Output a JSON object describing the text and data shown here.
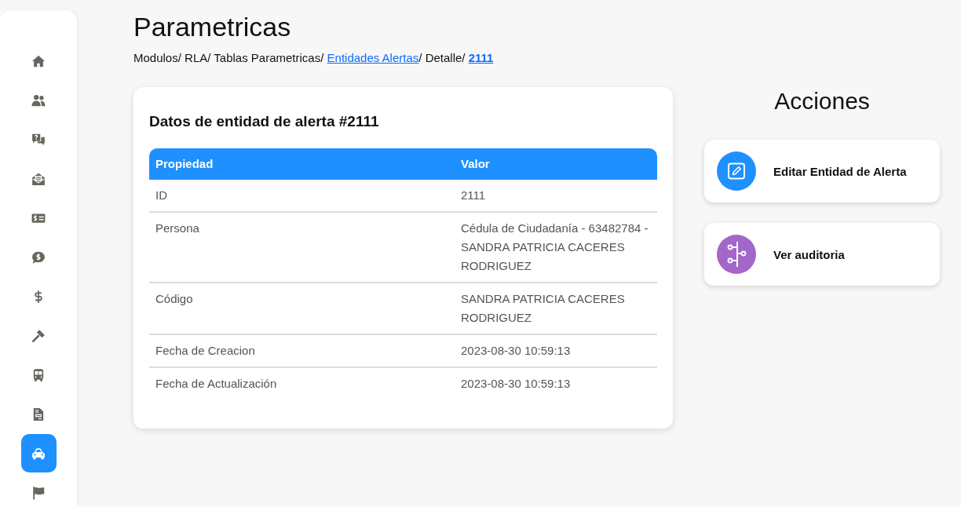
{
  "sidebar": {
    "items": [
      {
        "kind": "home",
        "selected": false
      },
      {
        "kind": "users",
        "selected": false
      },
      {
        "kind": "question-chat",
        "selected": false
      },
      {
        "kind": "envelope",
        "selected": false
      },
      {
        "kind": "money-check",
        "selected": false
      },
      {
        "kind": "dollar-chat",
        "selected": false
      },
      {
        "kind": "dollar",
        "selected": false
      },
      {
        "kind": "gavel",
        "selected": false
      },
      {
        "kind": "bus",
        "selected": false
      },
      {
        "kind": "document",
        "selected": false
      },
      {
        "kind": "car",
        "selected": true
      },
      {
        "kind": "flag",
        "selected": false
      }
    ]
  },
  "page": {
    "title": "Parametricas",
    "breadcrumb": {
      "separator": "/ ",
      "items": [
        {
          "label": "Modulos",
          "kind": "plain"
        },
        {
          "label": "RLA",
          "kind": "plain"
        },
        {
          "label": "Tablas Parametricas",
          "kind": "plain"
        },
        {
          "label": "Entidades Alertas",
          "kind": "link"
        },
        {
          "label": "Detalle",
          "kind": "plain"
        },
        {
          "label": "2111",
          "kind": "current"
        }
      ]
    }
  },
  "detail_card": {
    "title": "Datos de entidad de alerta #2111",
    "table": {
      "columns": [
        "Propiedad",
        "Valor"
      ],
      "rows": [
        [
          "ID",
          "2111"
        ],
        [
          "Persona",
          "Cédula de Ciudadanía - 63482784 - SANDRA PATRICIA CACERES RODRIGUEZ"
        ],
        [
          "Código",
          "SANDRA PATRICIA CACERES RODRIGUEZ"
        ],
        [
          "Fecha de Creacion",
          "2023-08-30 10:59:13"
        ],
        [
          "Fecha de Actualización",
          "2023-08-30 10:59:13"
        ]
      ]
    }
  },
  "actions": {
    "title": "Acciones",
    "items": [
      {
        "kind": "edit",
        "label": "Editar Entidad de Alerta",
        "color": "#1e90ff"
      },
      {
        "kind": "audit",
        "label": "Ver auditoria",
        "color": "#a366c9"
      }
    ]
  }
}
